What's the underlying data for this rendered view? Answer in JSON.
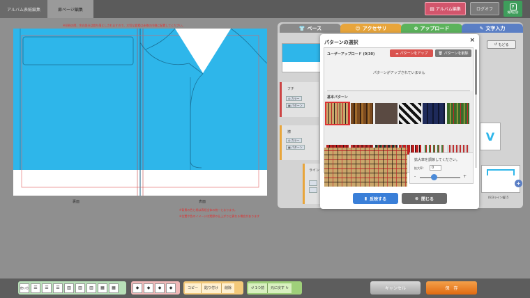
{
  "header": {
    "tab_album_cover": "アルバム表紙編集",
    "tab_page_edit": "扉ページ編集",
    "album_button": "アルバム編集",
    "logoff_button": "ログオフ",
    "help_button": "質問回答"
  },
  "canvas": {
    "notice_top": "※印刷の際、余白部分は裁ち落としされますので、大切な要素は赤線の内側に配置してください。",
    "label_back": "裏面",
    "label_front": "表面",
    "notice_bottom1": "※背景の色と柄は表紙全体の統一となります。",
    "notice_bottom2": "※位置や色のイメージは実際の仕上がりと異なる場合があります"
  },
  "panel": {
    "tabs": [
      "ベース",
      "アクセサリ",
      "アップロード",
      "文字入力"
    ],
    "back_button": "もどる",
    "section_edge": "フチ",
    "color_label": "カラー",
    "pattern_label": "パターン",
    "section_collar": "襟",
    "section_line": "ライン",
    "line_label": "(6)3ライン幅15"
  },
  "modal": {
    "title": "パターンの選択",
    "close": "×",
    "user_upload": "ユーザーアップロード (0/30)",
    "upload_button": "パターンをアップ",
    "delete_button": "パターンを削除",
    "no_upload": "パターンがアップされていません",
    "basic_patterns": "基本パターン",
    "zoom_title": "拡大率を調節してください。",
    "zoom_label": "拡大率：",
    "zoom_value": "0",
    "minus": "-",
    "plus": "+",
    "apply_button": "反映する",
    "close_button": "閉じる"
  },
  "bottom": {
    "copy": "コピー",
    "paste": "貼り付け",
    "delete": "削除",
    "undo": "1つ前",
    "redo": "元に戻す",
    "cancel": "キャンセル",
    "save": "保　存",
    "first_btn": "使い方"
  },
  "colors": {
    "shirt": "#2eb6ea",
    "accent_red": "#d2556c",
    "help_green": "#3e9d5b",
    "orange": "#e87a20",
    "blue_btn": "#3a7fd8"
  }
}
